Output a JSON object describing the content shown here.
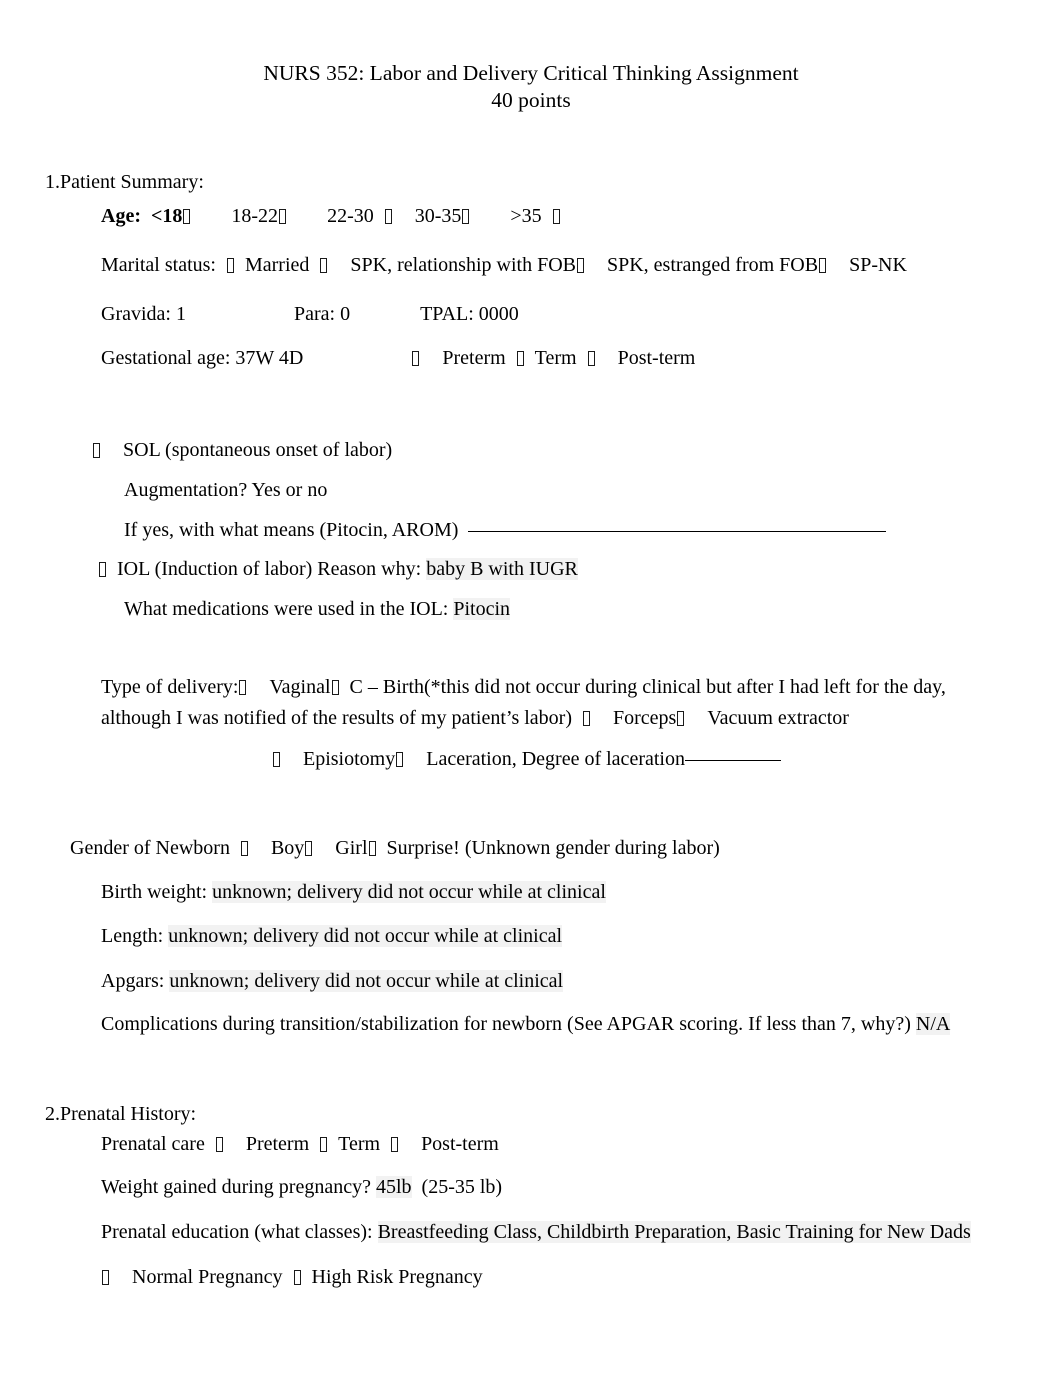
{
  "document": {
    "title_line1": "NURS 352: Labor and Delivery Critical Thinking Assignment",
    "title_line2": "40 points"
  },
  "section1": {
    "heading": "1.Patient Summary:",
    "age": {
      "label": "Age:",
      "options": [
        "<18",
        "18-22",
        "22-30",
        "30-35",
        ">35"
      ]
    },
    "marital": {
      "label": "Marital status:",
      "options": [
        "Married",
        "SPK, relationship with FOB",
        "SPK, estranged from FOB",
        "SP-NK"
      ]
    },
    "obstetric": {
      "gravida": "Gravida: 1",
      "para": "Para: 0",
      "tpal": "TPAL: 0000"
    },
    "gestational": {
      "label": "Gestational age: 37W 4D",
      "options": [
        "Preterm",
        "Term",
        "Post-term"
      ]
    },
    "onset": {
      "sol_label": "SOL (spontaneous onset of labor)",
      "augmentation": "Augmentation? Yes or no",
      "if_yes": "If yes, with what means (Pitocin, AROM)",
      "iol_label": "IOL (Induction of labor) Reason why:",
      "iol_answer": "baby B with IUGR",
      "iol_meds_label": "What medications were used in the IOL:",
      "iol_meds_answer": "Pitocin"
    },
    "delivery": {
      "label": "Type of delivery:",
      "option_vaginal": "Vaginal",
      "option_csection": "C – Birth(*this did not occur during clinical but after I had left for the day, although I was notified of the results of my patient’s labor)",
      "option_forceps": "Forceps",
      "option_vacuum": "Vacuum extractor",
      "option_episiotomy": "Episiotomy",
      "option_laceration": "Laceration, Degree of laceration"
    },
    "newborn": {
      "gender_label": "Gender of Newborn",
      "gender_boy": "Boy",
      "gender_girl": "Girl",
      "gender_surprise": "Surprise! (Unknown gender during labor)",
      "birth_weight_label": "Birth weight:",
      "birth_weight_answer": "unknown; delivery did not occur while at clinical",
      "length_label": "Length:",
      "length_answer": "unknown; delivery did not occur while at clinical",
      "apgars_label": "Apgars:",
      "apgars_answer": "unknown; delivery did not occur while at clinical",
      "complications_label": "Complications during transition/stabilization for newborn (See APGAR scoring. If less than 7, why?)",
      "complications_answer": "N/A"
    }
  },
  "section2": {
    "heading": "2.Prenatal History:",
    "prenatal_care": {
      "label": "Prenatal care",
      "options": [
        "Preterm",
        "Term",
        "Post-term"
      ]
    },
    "weight": {
      "label": "Weight gained during pregnancy?",
      "answer": "45lb",
      "range": "(25-35 lb)"
    },
    "education": {
      "label": "Prenatal education (what classes):",
      "answer": "Breastfeeding Class, Childbirth Preparation, Basic Training for New Dads"
    },
    "risk": {
      "normal": "Normal Pregnancy",
      "high_risk": "High Risk Pregnancy"
    }
  }
}
